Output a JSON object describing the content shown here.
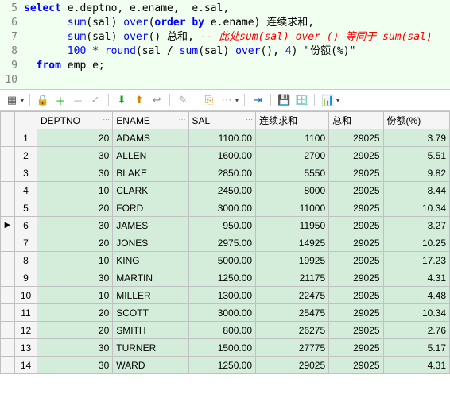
{
  "code": {
    "lines": [
      {
        "num": 5,
        "html": "<span class='kw'>select</span> e.deptno, e.ename,  e.sal,"
      },
      {
        "num": 6,
        "html": "       <span class='fn'>sum</span>(sal) <span class='fn'>over</span>(<span class='kw'>order by</span> e.ename) 连续求和,"
      },
      {
        "num": 7,
        "html": "       <span class='fn'>sum</span>(sal) <span class='fn'>over</span>() 总和, <span class='comment'>-- 此处sum(sal) over () 等同于 sum(sal)</span>"
      },
      {
        "num": 8,
        "html": "       <span class='fn'>100</span> * <span class='fn'>round</span>(sal / <span class='fn'>sum</span>(sal) <span class='fn'>over</span>(), <span class='fn'>4</span>) <span class='str'>\"份额(%)\"</span>"
      },
      {
        "num": 9,
        "html": "  <span class='kw'>from</span> emp e;"
      },
      {
        "num": 10,
        "html": ""
      }
    ]
  },
  "toolbar": {
    "icons": [
      "grid-icon",
      "lock-icon",
      "plus-icon",
      "minus-icon",
      "check-icon",
      "down-green-icon",
      "up-arrow-icon",
      "curve-icon",
      "edit-icon",
      "copy-icon",
      "dots-icon",
      "link-icon",
      "save-icon",
      "db-icon",
      "chart-icon"
    ]
  },
  "columns": [
    "DEPTNO",
    "ENAME",
    "SAL",
    "连续求和",
    "总和",
    "份额(%)"
  ],
  "col_align": [
    "num",
    "txt",
    "num",
    "num",
    "num",
    "num"
  ],
  "rows": [
    {
      "n": 1,
      "m": "",
      "d": [
        "20",
        "ADAMS",
        "1100.00",
        "1100",
        "29025",
        "3.79"
      ]
    },
    {
      "n": 2,
      "m": "",
      "d": [
        "30",
        "ALLEN",
        "1600.00",
        "2700",
        "29025",
        "5.51"
      ]
    },
    {
      "n": 3,
      "m": "",
      "d": [
        "30",
        "BLAKE",
        "2850.00",
        "5550",
        "29025",
        "9.82"
      ]
    },
    {
      "n": 4,
      "m": "",
      "d": [
        "10",
        "CLARK",
        "2450.00",
        "8000",
        "29025",
        "8.44"
      ]
    },
    {
      "n": 5,
      "m": "",
      "d": [
        "20",
        "FORD",
        "3000.00",
        "11000",
        "29025",
        "10.34"
      ]
    },
    {
      "n": 6,
      "m": "▶",
      "d": [
        "30",
        "JAMES",
        "950.00",
        "11950",
        "29025",
        "3.27"
      ]
    },
    {
      "n": 7,
      "m": "",
      "d": [
        "20",
        "JONES",
        "2975.00",
        "14925",
        "29025",
        "10.25"
      ]
    },
    {
      "n": 8,
      "m": "",
      "d": [
        "10",
        "KING",
        "5000.00",
        "19925",
        "29025",
        "17.23"
      ]
    },
    {
      "n": 9,
      "m": "",
      "d": [
        "30",
        "MARTIN",
        "1250.00",
        "21175",
        "29025",
        "4.31"
      ]
    },
    {
      "n": 10,
      "m": "",
      "d": [
        "10",
        "MILLER",
        "1300.00",
        "22475",
        "29025",
        "4.48"
      ]
    },
    {
      "n": 11,
      "m": "",
      "d": [
        "20",
        "SCOTT",
        "3000.00",
        "25475",
        "29025",
        "10.34"
      ]
    },
    {
      "n": 12,
      "m": "",
      "d": [
        "20",
        "SMITH",
        "800.00",
        "26275",
        "29025",
        "2.76"
      ]
    },
    {
      "n": 13,
      "m": "",
      "d": [
        "30",
        "TURNER",
        "1500.00",
        "27775",
        "29025",
        "5.17"
      ]
    },
    {
      "n": 14,
      "m": "",
      "d": [
        "30",
        "WARD",
        "1250.00",
        "29025",
        "29025",
        "4.31"
      ]
    }
  ]
}
